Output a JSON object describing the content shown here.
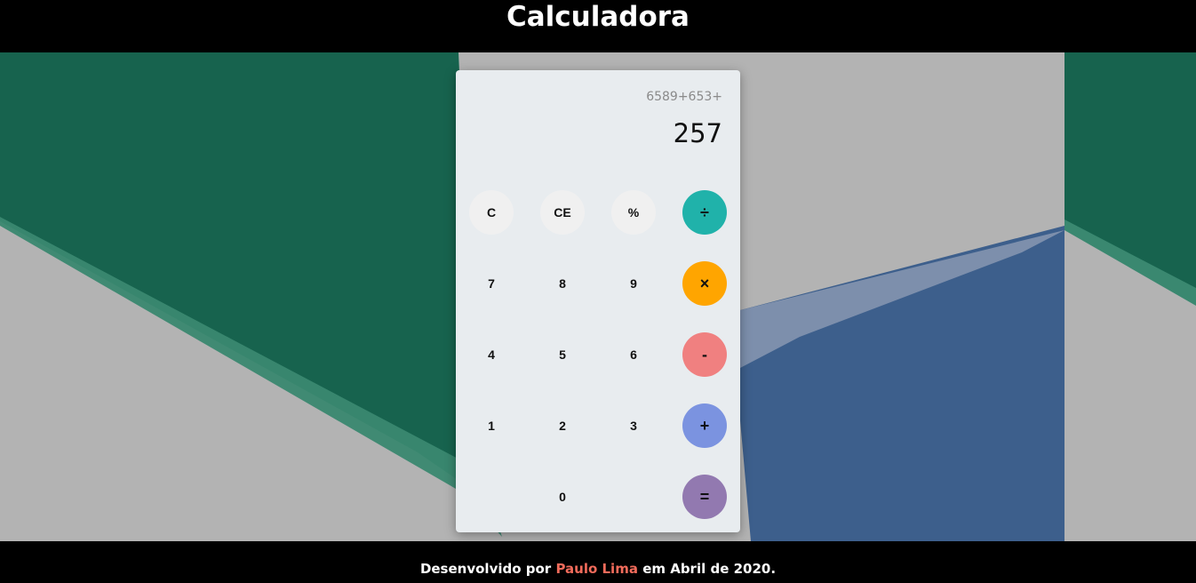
{
  "header": {
    "title": "Calculadora"
  },
  "display": {
    "history": "6589+653+",
    "result": "257"
  },
  "keys": {
    "clear": "C",
    "clear_entry": "CE",
    "percent": "%",
    "divide": "÷",
    "seven": "7",
    "eight": "8",
    "nine": "9",
    "multiply": "×",
    "four": "4",
    "five": "5",
    "six": "6",
    "subtract": "-",
    "one": "1",
    "two": "2",
    "three": "3",
    "add": "+",
    "zero": "0",
    "equals": "="
  },
  "colors": {
    "divide": "#20b2aa",
    "multiply": "#ffa500",
    "subtract": "#f08080",
    "add": "#7b93e0",
    "equals": "#9279b0",
    "author": "#f26b5b",
    "bg_green": "#17634e",
    "bg_blue": "#3d5f8c"
  },
  "footer": {
    "prefix": "Desenvolvido por",
    "author": "Paulo Lima",
    "suffix": "em Abril de 2020."
  }
}
